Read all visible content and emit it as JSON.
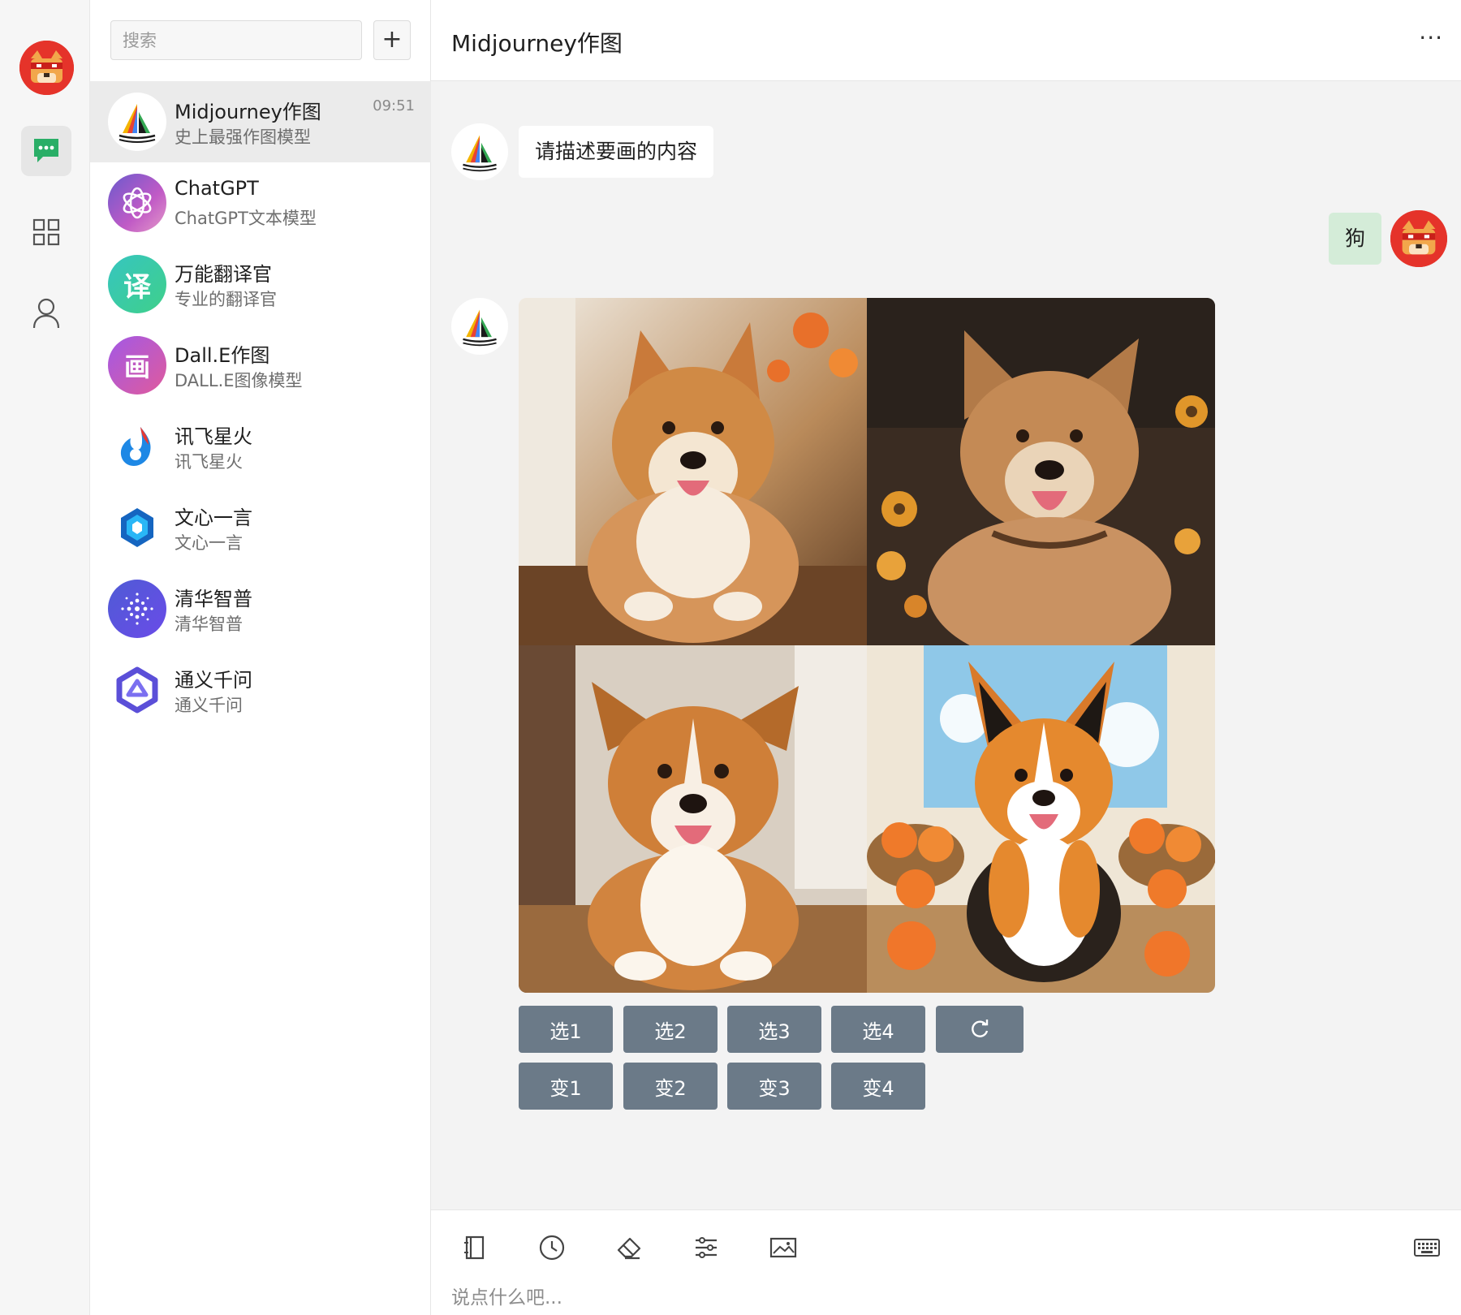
{
  "sidebar": {
    "nav": [
      {
        "icon": "chat-bubble-icon",
        "active": true
      },
      {
        "icon": "apps-grid-icon",
        "active": false
      },
      {
        "icon": "user-icon",
        "active": false
      }
    ]
  },
  "conversation_list": {
    "search_placeholder": "搜索",
    "add_label": "+",
    "items": [
      {
        "title": "Midjourney作图",
        "subtitle": "史上最强作图模型",
        "time": "09:51",
        "selected": true
      },
      {
        "title": "ChatGPT",
        "subtitle": "ChatGPT文本模型",
        "time": ""
      },
      {
        "title": "万能翻译官",
        "subtitle": "专业的翻译官",
        "time": ""
      },
      {
        "title": "Dall.E作图",
        "subtitle": "DALL.E图像模型",
        "time": ""
      },
      {
        "title": "讯飞星火",
        "subtitle": "讯飞星火",
        "time": ""
      },
      {
        "title": "文心一言",
        "subtitle": "文心一言",
        "time": ""
      },
      {
        "title": "清华智普",
        "subtitle": "清华智普",
        "time": ""
      },
      {
        "title": "通义千问",
        "subtitle": "通义千问",
        "time": ""
      }
    ]
  },
  "chat": {
    "title": "Midjourney作图",
    "more_label": "···",
    "messages": [
      {
        "from": "bot",
        "text": "请描述要画的内容"
      },
      {
        "from": "user",
        "text": "狗"
      }
    ],
    "image_actions": {
      "row1": [
        "选1",
        "选2",
        "选3",
        "选4"
      ],
      "row2": [
        "变1",
        "变2",
        "变3",
        "变4"
      ]
    },
    "input_placeholder": "说点什么吧..."
  },
  "colors": {
    "accent_green": "#2aae67",
    "action_button": "#6b7a88",
    "user_bubble": "#d4ecd8",
    "avatar_red": "#e5332a"
  }
}
